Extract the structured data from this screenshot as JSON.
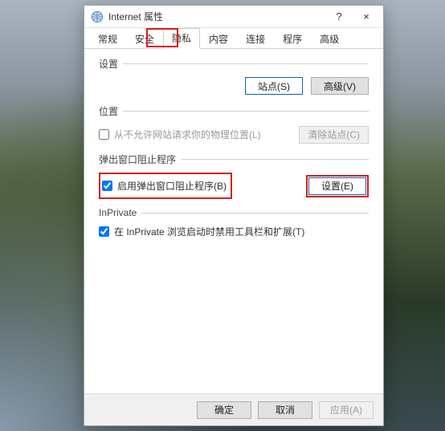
{
  "title": "Internet 属性",
  "titlebar": {
    "help": "?",
    "close": "×"
  },
  "tabs": [
    {
      "label": "常规"
    },
    {
      "label": "安全"
    },
    {
      "label": "隐私",
      "active": true
    },
    {
      "label": "内容"
    },
    {
      "label": "连接"
    },
    {
      "label": "程序"
    },
    {
      "label": "高级"
    }
  ],
  "sections": {
    "settings": {
      "label": "设置",
      "sites_btn": "站点(S)",
      "advanced_btn": "高级(V)"
    },
    "location": {
      "label": "位置",
      "checkbox": "从不允许网站请求你的物理位置(L)",
      "clear_btn": "清除站点(C)"
    },
    "popup": {
      "label": "弹出窗口阻止程序",
      "checkbox": "启用弹出窗口阻止程序(B)",
      "settings_btn": "设置(E)"
    },
    "inprivate": {
      "label": "InPrivate",
      "checkbox": "在 InPrivate 浏览启动时禁用工具栏和扩展(T)"
    }
  },
  "footer": {
    "ok": "确定",
    "cancel": "取消",
    "apply": "应用(A)"
  }
}
